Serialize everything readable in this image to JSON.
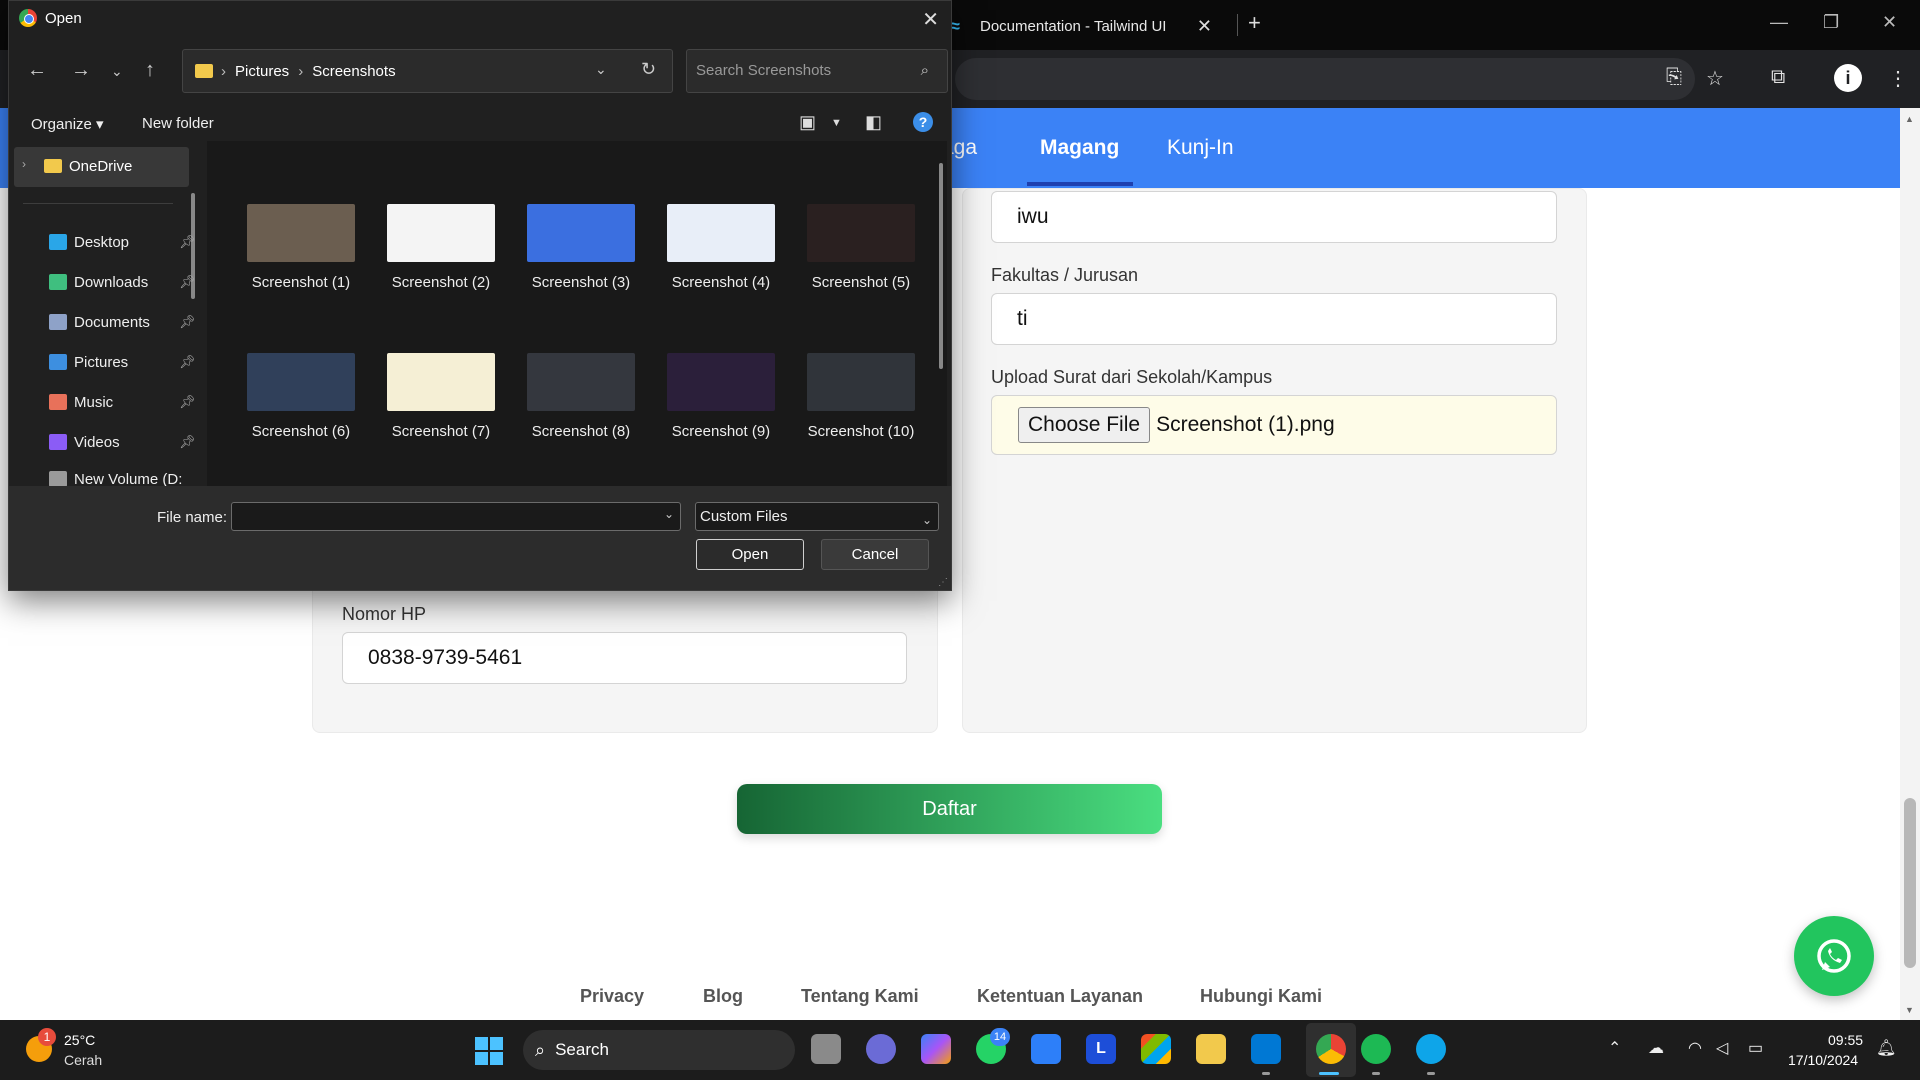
{
  "browser": {
    "tab_title": "Documentation - Tailwind UI",
    "tab_close": "✕",
    "new_tab": "+"
  },
  "page": {
    "nav": [
      {
        "label": "aga"
      },
      {
        "label": "Magang"
      },
      {
        "label": "Kunj-In"
      }
    ],
    "fields": {
      "institution_value": "iwu",
      "faculty_label": "Fakultas / Jurusan",
      "faculty_value": "ti",
      "upload_label": "Upload Surat dari Sekolah/Kampus",
      "upload_button": "Choose File",
      "upload_filename": "Screenshot (1).png",
      "phone_label": "Nomor HP",
      "phone_value": "0838-9739-5461"
    },
    "submit_label": "Daftar",
    "footer_links": [
      "Privacy",
      "Blog",
      "Tentang Kami",
      "Ketentuan Layanan",
      "Hubungi Kami"
    ]
  },
  "dialog": {
    "title": "Open",
    "breadcrumb": [
      "Pictures",
      "Screenshots"
    ],
    "search_placeholder": "Search Screenshots",
    "organize_label": "Organize ▾",
    "new_folder_label": "New folder",
    "sidebar": {
      "onedrive": "OneDrive",
      "items": [
        {
          "label": "Desktop",
          "color": "#2aa6e8"
        },
        {
          "label": "Downloads",
          "color": "#3fbf7f"
        },
        {
          "label": "Documents",
          "color": "#8ea2c8"
        },
        {
          "label": "Pictures",
          "color": "#3d8fe0"
        },
        {
          "label": "Music",
          "color": "#e8715a"
        },
        {
          "label": "Videos",
          "color": "#8b5cf6"
        },
        {
          "label": "New Volume (D:",
          "color": "#9a9a9a"
        }
      ]
    },
    "files": [
      {
        "name": "Screenshot (1)",
        "preview": "#6b5e50"
      },
      {
        "name": "Screenshot (2)",
        "preview": "#f4f4f4"
      },
      {
        "name": "Screenshot (3)",
        "preview": "#3b6fe0"
      },
      {
        "name": "Screenshot (4)",
        "preview": "#e8eef8"
      },
      {
        "name": "Screenshot (5)",
        "preview": "#2a2020"
      },
      {
        "name": "Screenshot (6)",
        "preview": "#30405a"
      },
      {
        "name": "Screenshot (7)",
        "preview": "#f5efd5"
      },
      {
        "name": "Screenshot (8)",
        "preview": "#34373e"
      },
      {
        "name": "Screenshot (9)",
        "preview": "#2b1f3a"
      },
      {
        "name": "Screenshot (10)",
        "preview": "#30343a"
      }
    ],
    "file_name_label": "File name:",
    "file_name_value": "",
    "filter_value": "Custom Files",
    "open_label": "Open",
    "cancel_label": "Cancel"
  },
  "taskbar": {
    "temperature": "25°C",
    "weather": "Cerah",
    "weather_badge": "1",
    "search_label": "Search",
    "whatsapp_badge": "14",
    "time": "09:55",
    "date": "17/10/2024"
  },
  "colors": {
    "nav_blue": "#3b82f6",
    "daftar_from": "#166534",
    "daftar_to": "#4ade80",
    "whatsapp": "#22c55e"
  }
}
